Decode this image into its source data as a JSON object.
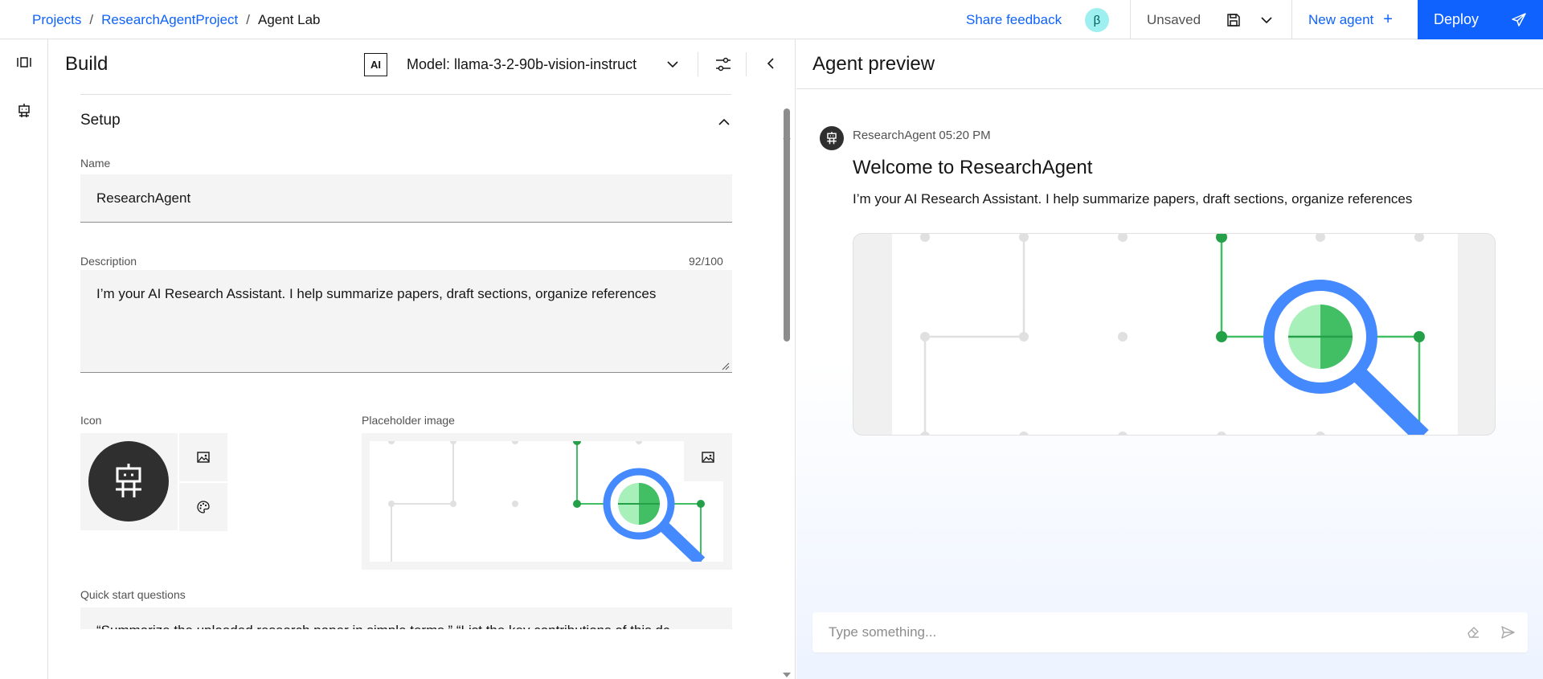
{
  "breadcrumb": {
    "items": [
      "Projects",
      "ResearchAgentProject"
    ],
    "current": "Agent Lab",
    "separator": "/"
  },
  "topbar": {
    "share_feedback": "Share feedback",
    "beta_badge": "β",
    "save_status": "Unsaved",
    "new_agent": "New agent",
    "new_agent_icon": "+",
    "deploy": "Deploy"
  },
  "build": {
    "title": "Build",
    "ai_badge": "AI",
    "model_label": "Model: llama-3-2-90b-vision-instruct",
    "setup": {
      "heading": "Setup",
      "name_label": "Name",
      "name_value": "ResearchAgent",
      "description_label": "Description",
      "description_counter": "92/100",
      "description_value": "I’m your AI Research Assistant. I help summarize papers, draft sections, organize references",
      "icon_label": "Icon",
      "placeholder_image_label": "Placeholder image",
      "quick_start_label": "Quick start questions",
      "quick_start_value": "“Summarize the uploaded research paper in simple terms.”  “List the key contributions of this dc"
    }
  },
  "preview": {
    "title": "Agent preview",
    "sender": "ResearchAgent",
    "time": "05:20 PM",
    "welcome": "Welcome to ResearchAgent",
    "intro": "I’m your AI Research Assistant. I help summarize papers, draft sections, organize references",
    "input_placeholder": "Type something..."
  },
  "colors": {
    "primary": "#0f62fe",
    "green": "#42be65",
    "magnifier_blue": "#4589ff",
    "avatar_bg": "#2f2f2f",
    "field_bg": "#f4f4f4"
  },
  "icons": [
    "save-icon",
    "chevron-down-icon",
    "send-icon",
    "layers-icon",
    "robot-icon",
    "tune-icon",
    "collapse-left-icon",
    "chevron-up-icon",
    "image-icon",
    "palette-icon",
    "eraser-icon"
  ]
}
